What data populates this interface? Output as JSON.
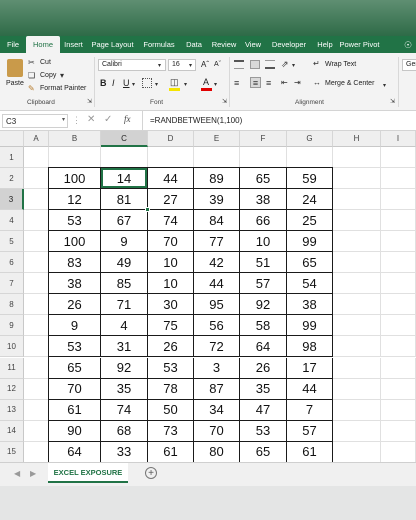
{
  "ribbon_tabs": [
    "File",
    "Home",
    "Insert",
    "Page Layout",
    "Formulas",
    "Data",
    "Review",
    "View",
    "Developer",
    "Help",
    "Power Pivot"
  ],
  "active_tab": "Home",
  "clipboard": {
    "paste": "Paste",
    "cut": "Cut",
    "copy": "Copy",
    "format_painter": "Format Painter",
    "label": "Clipboard"
  },
  "font": {
    "name": "Calibri",
    "size": "16",
    "label": "Font",
    "bold": "B",
    "italic": "I",
    "underline": "U"
  },
  "alignment": {
    "wrap": "Wrap Text",
    "merge": "Merge & Center",
    "label": "Alignment"
  },
  "number_format_partial": "Ger",
  "name_box": "C3",
  "formula": "=RANDBETWEEN(1,100)",
  "columns": [
    "A",
    "B",
    "C",
    "D",
    "E",
    "F",
    "G",
    "H",
    "I"
  ],
  "rows": [
    "1",
    "2",
    "3",
    "4",
    "5",
    "6",
    "7",
    "8",
    "9",
    "10",
    "11",
    "12",
    "13",
    "14",
    "15"
  ],
  "table": [
    [
      100,
      14,
      44,
      89,
      65,
      59
    ],
    [
      12,
      81,
      27,
      39,
      38,
      24
    ],
    [
      53,
      67,
      74,
      84,
      66,
      25
    ],
    [
      100,
      9,
      70,
      77,
      10,
      99
    ],
    [
      83,
      49,
      10,
      42,
      51,
      65
    ],
    [
      38,
      85,
      10,
      44,
      57,
      54
    ],
    [
      26,
      71,
      30,
      95,
      92,
      38
    ],
    [
      9,
      4,
      75,
      56,
      58,
      99
    ],
    [
      53,
      31,
      26,
      72,
      64,
      98
    ],
    [
      65,
      92,
      53,
      3,
      26,
      17
    ],
    [
      70,
      35,
      78,
      87,
      35,
      44
    ],
    [
      61,
      74,
      50,
      34,
      47,
      7
    ],
    [
      90,
      68,
      73,
      70,
      53,
      57
    ],
    [
      64,
      33,
      61,
      80,
      65,
      61
    ]
  ],
  "sheet_tab": "EXCEL EXPOSURE",
  "colors": {
    "excel_green": "#217346",
    "selection": "#217346"
  }
}
